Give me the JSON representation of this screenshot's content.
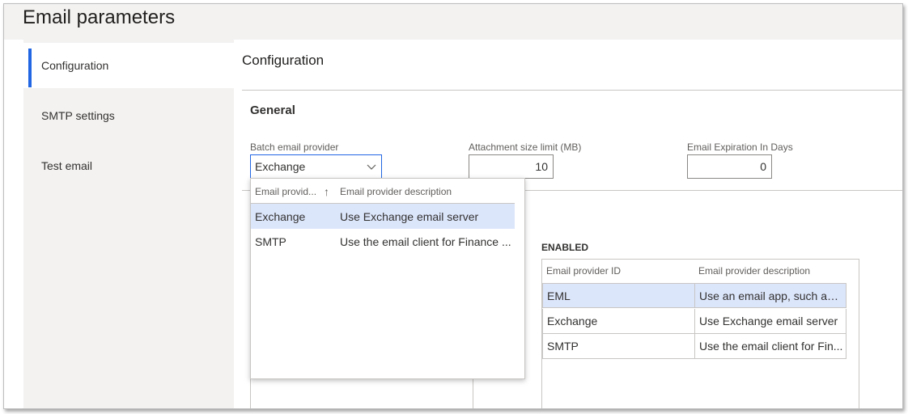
{
  "page": {
    "title": "Email parameters"
  },
  "nav": {
    "items": [
      {
        "label": "Configuration"
      },
      {
        "label": "SMTP settings"
      },
      {
        "label": "Test email"
      }
    ]
  },
  "section": {
    "title": "Configuration",
    "group_title": "General"
  },
  "fields": {
    "batch_provider": {
      "label": "Batch email provider",
      "value": "Exchange"
    },
    "attachment_limit": {
      "label": "Attachment size limit (MB)",
      "value": "10"
    },
    "expiration_days": {
      "label": "Email Expiration In Days",
      "value": "0"
    }
  },
  "dropdown": {
    "headers": [
      "Email provid...",
      "Email provider description"
    ],
    "sort_glyph": "↑",
    "rows": [
      {
        "id": "Exchange",
        "description": "Use Exchange email server"
      },
      {
        "id": "SMTP",
        "description": "Use the email client for Finance ..."
      }
    ]
  },
  "enabled": {
    "label": "ENABLED",
    "headers": [
      "Email provider ID",
      "Email provider description"
    ],
    "rows": [
      {
        "id": "EML",
        "description": "Use an email app, such as ..."
      },
      {
        "id": "Exchange",
        "description": "Use Exchange email server"
      },
      {
        "id": "SMTP",
        "description": "Use the email client for Fin..."
      }
    ]
  },
  "colors": {
    "accent": "#2266e3",
    "selected_row": "#dce6fb",
    "rail": "#f3f2f1"
  },
  "icons": {
    "dropdown": "chevron-down-icon",
    "sort": "sort-ascending-icon"
  }
}
